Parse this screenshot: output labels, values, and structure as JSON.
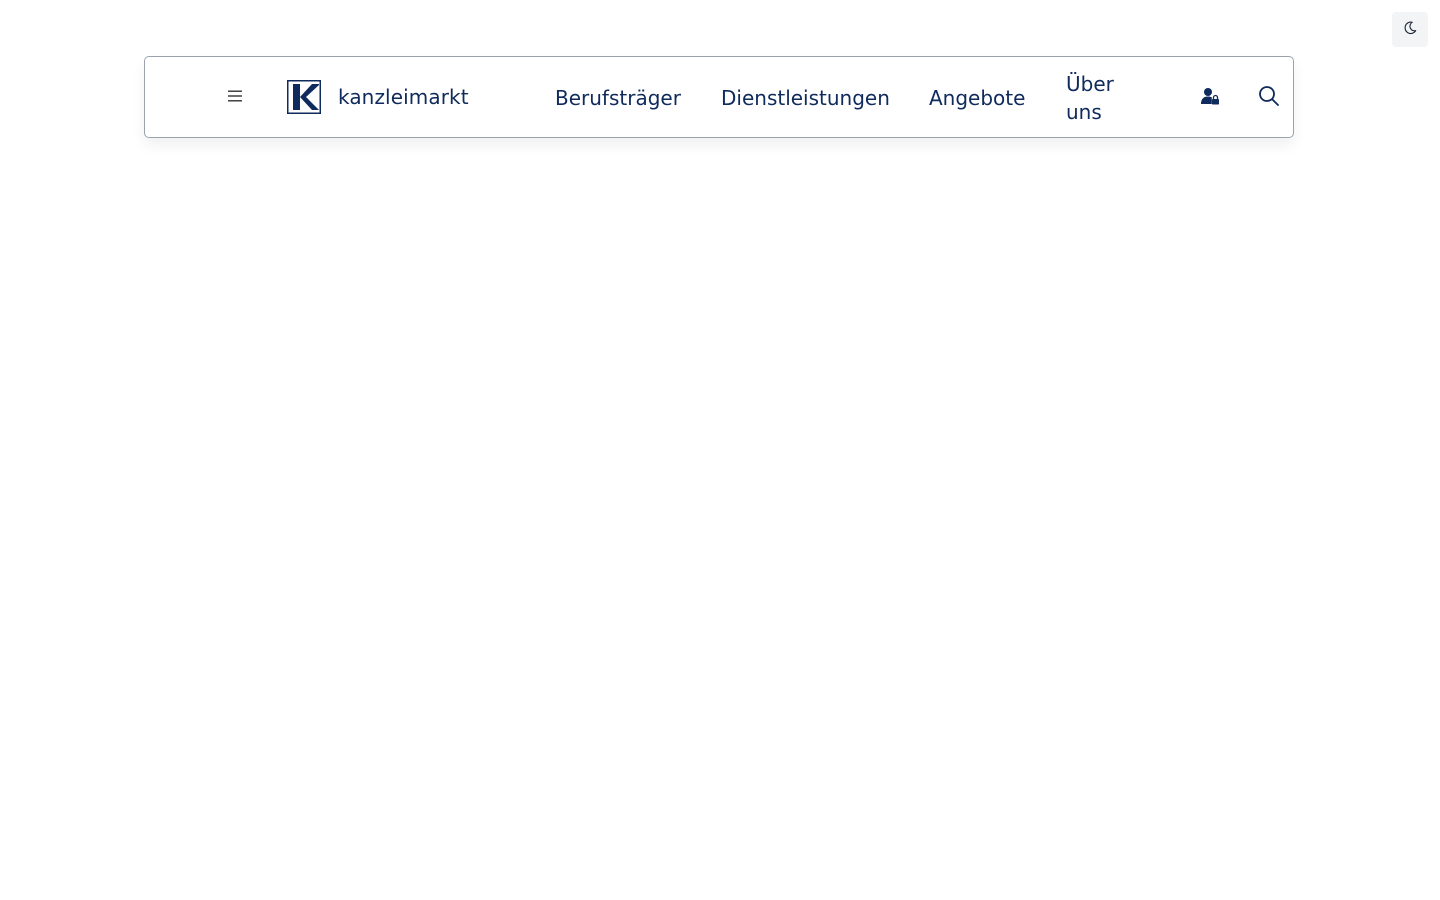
{
  "header": {
    "brand_name": "kanzleimarkt",
    "nav": [
      {
        "label": "Berufsträger"
      },
      {
        "label": "Dienstleistungen"
      },
      {
        "label": "Angebote"
      },
      {
        "label": "Über uns"
      }
    ]
  },
  "icons": {
    "theme_toggle": "moon-icon",
    "menu": "hamburger-menu-icon",
    "logo": "k-logo-icon",
    "account": "user-lock-icon",
    "search": "search-icon"
  },
  "colors": {
    "brand": "#0f2a5c",
    "border": "#9aa3ad",
    "toggle_bg": "#f3f4f6"
  }
}
